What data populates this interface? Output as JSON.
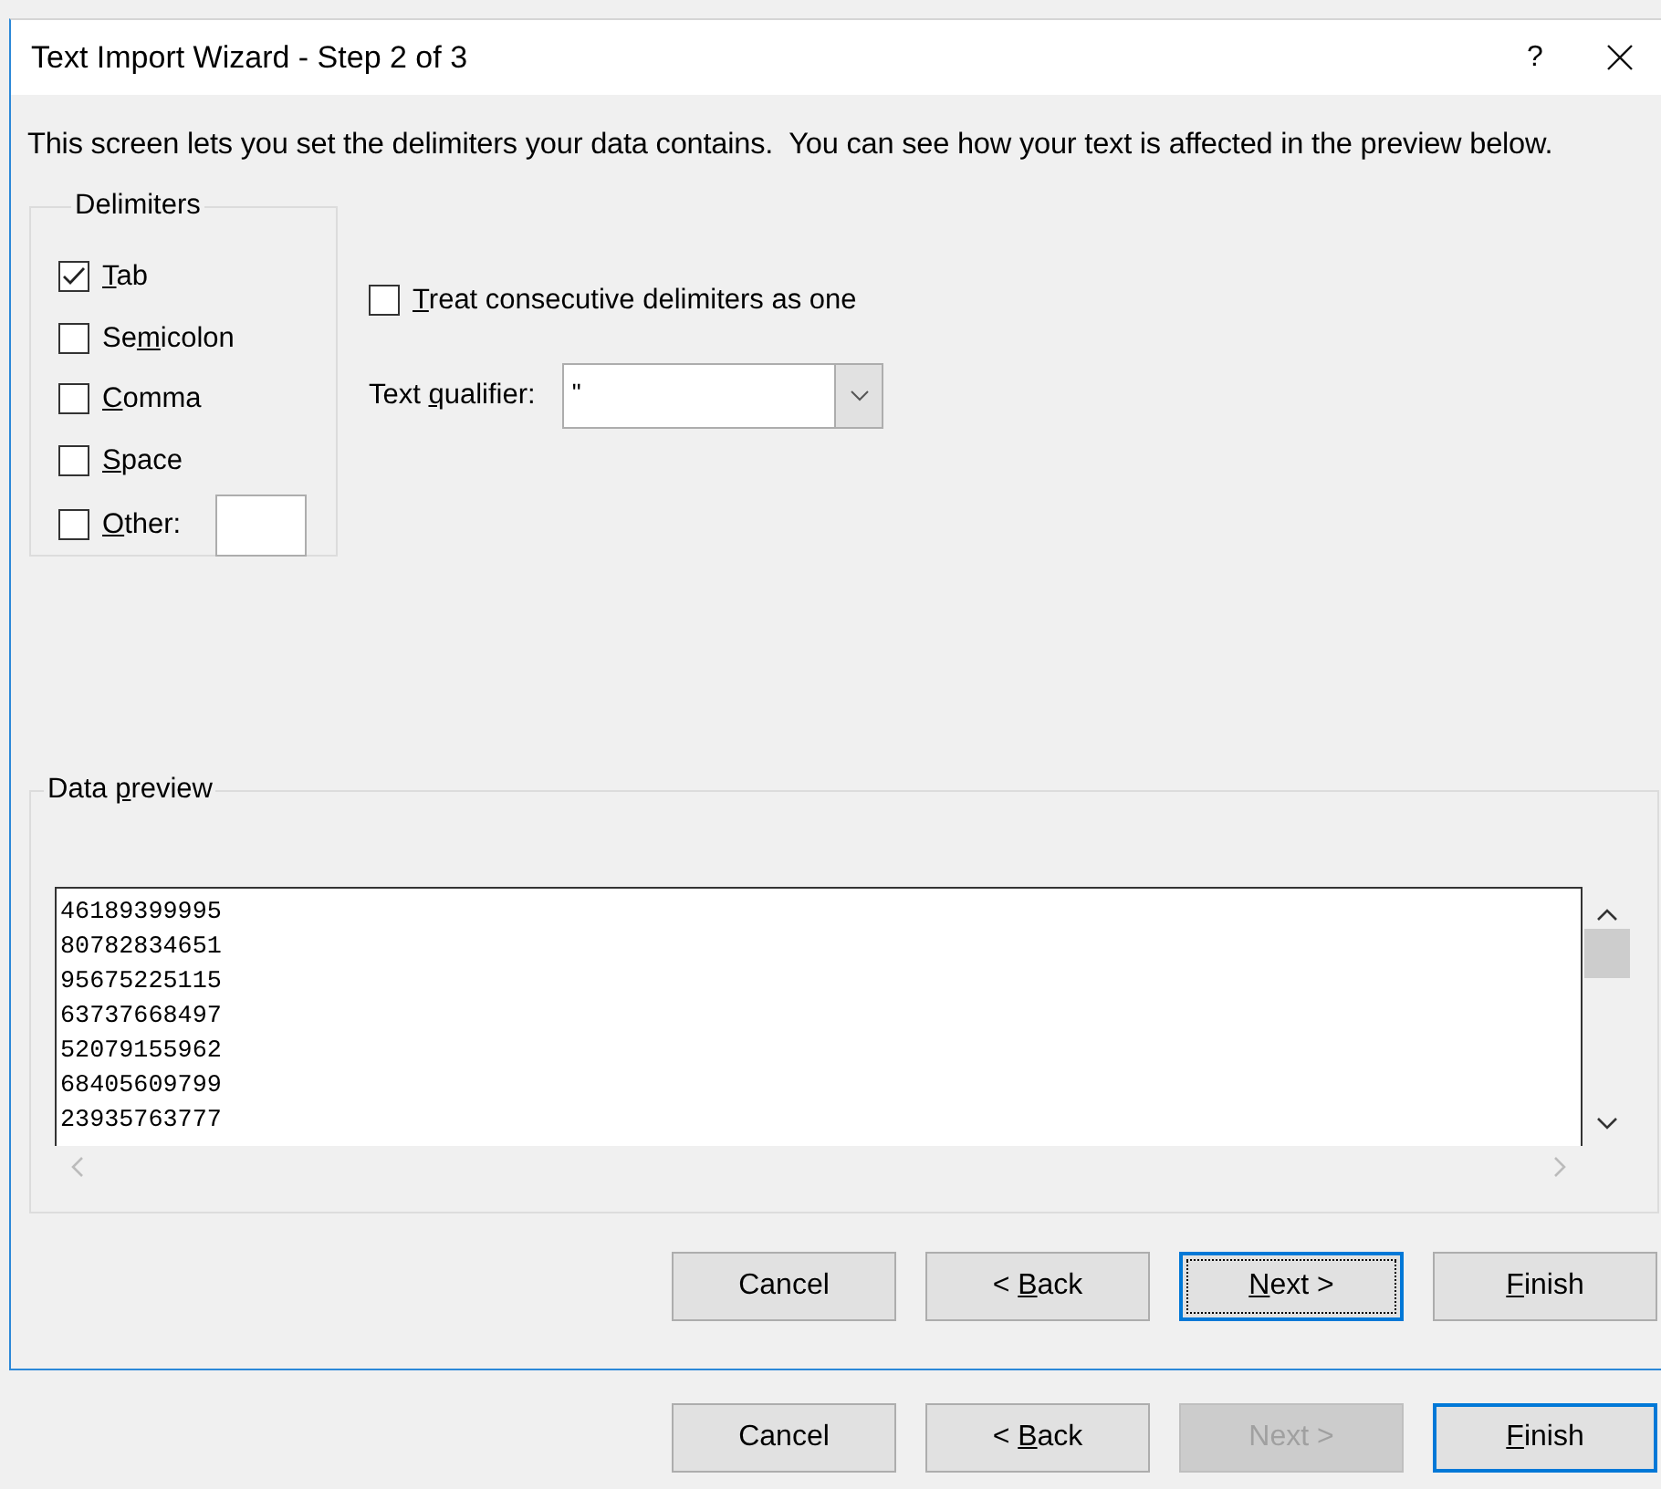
{
  "window": {
    "title": "Text Import Wizard - Step 2 of 3",
    "help": "?"
  },
  "instruction": "This screen lets you set the delimiters your data contains.  You can see how your text is affected in the preview below.",
  "delimiters": {
    "title": "Delimiters",
    "items": [
      {
        "key": "T",
        "after": "ab",
        "checked": true
      },
      {
        "before": "Se",
        "key": "m",
        "after": "icolon",
        "checked": false
      },
      {
        "key": "C",
        "after": "omma",
        "checked": false
      },
      {
        "key": "S",
        "after": "pace",
        "checked": false
      },
      {
        "key": "O",
        "after": "ther:",
        "checked": false,
        "kind": "other"
      }
    ]
  },
  "consecutive": {
    "key": "T",
    "after": "reat consecutive delimiters as one",
    "checked": false
  },
  "text_qualifier": {
    "label": {
      "before": "Text ",
      "key": "q",
      "after": "ualifier:"
    },
    "value": "\""
  },
  "data_preview": {
    "title": {
      "before": "Data ",
      "key": "p",
      "after": "review"
    },
    "lines": [
      "46189399995",
      "80782834651",
      "95675225115",
      "63737668497",
      "52079155962",
      "68405609799",
      "23935763777"
    ]
  },
  "buttons": [
    {
      "before": "Cancel",
      "focused": false,
      "default": false,
      "disabled": false
    },
    {
      "before": "< ",
      "key": "B",
      "after": "ack",
      "focused": false,
      "default": false,
      "disabled": false
    },
    {
      "key": "N",
      "after": "ext >",
      "focused": true,
      "default": false,
      "disabled": false
    },
    {
      "key": "F",
      "after": "inish",
      "focused": false,
      "default": false,
      "disabled": false
    }
  ],
  "background_window": {
    "buttons": [
      {
        "before": "Cancel",
        "focused": false,
        "default": false,
        "disabled": false
      },
      {
        "before": "< ",
        "key": "B",
        "after": "ack",
        "focused": false,
        "default": false,
        "disabled": false
      },
      {
        "before": "Next >",
        "focused": false,
        "default": false,
        "disabled": true
      },
      {
        "key": "F",
        "after": "inish",
        "focused": false,
        "default": true,
        "disabled": false
      }
    ]
  }
}
